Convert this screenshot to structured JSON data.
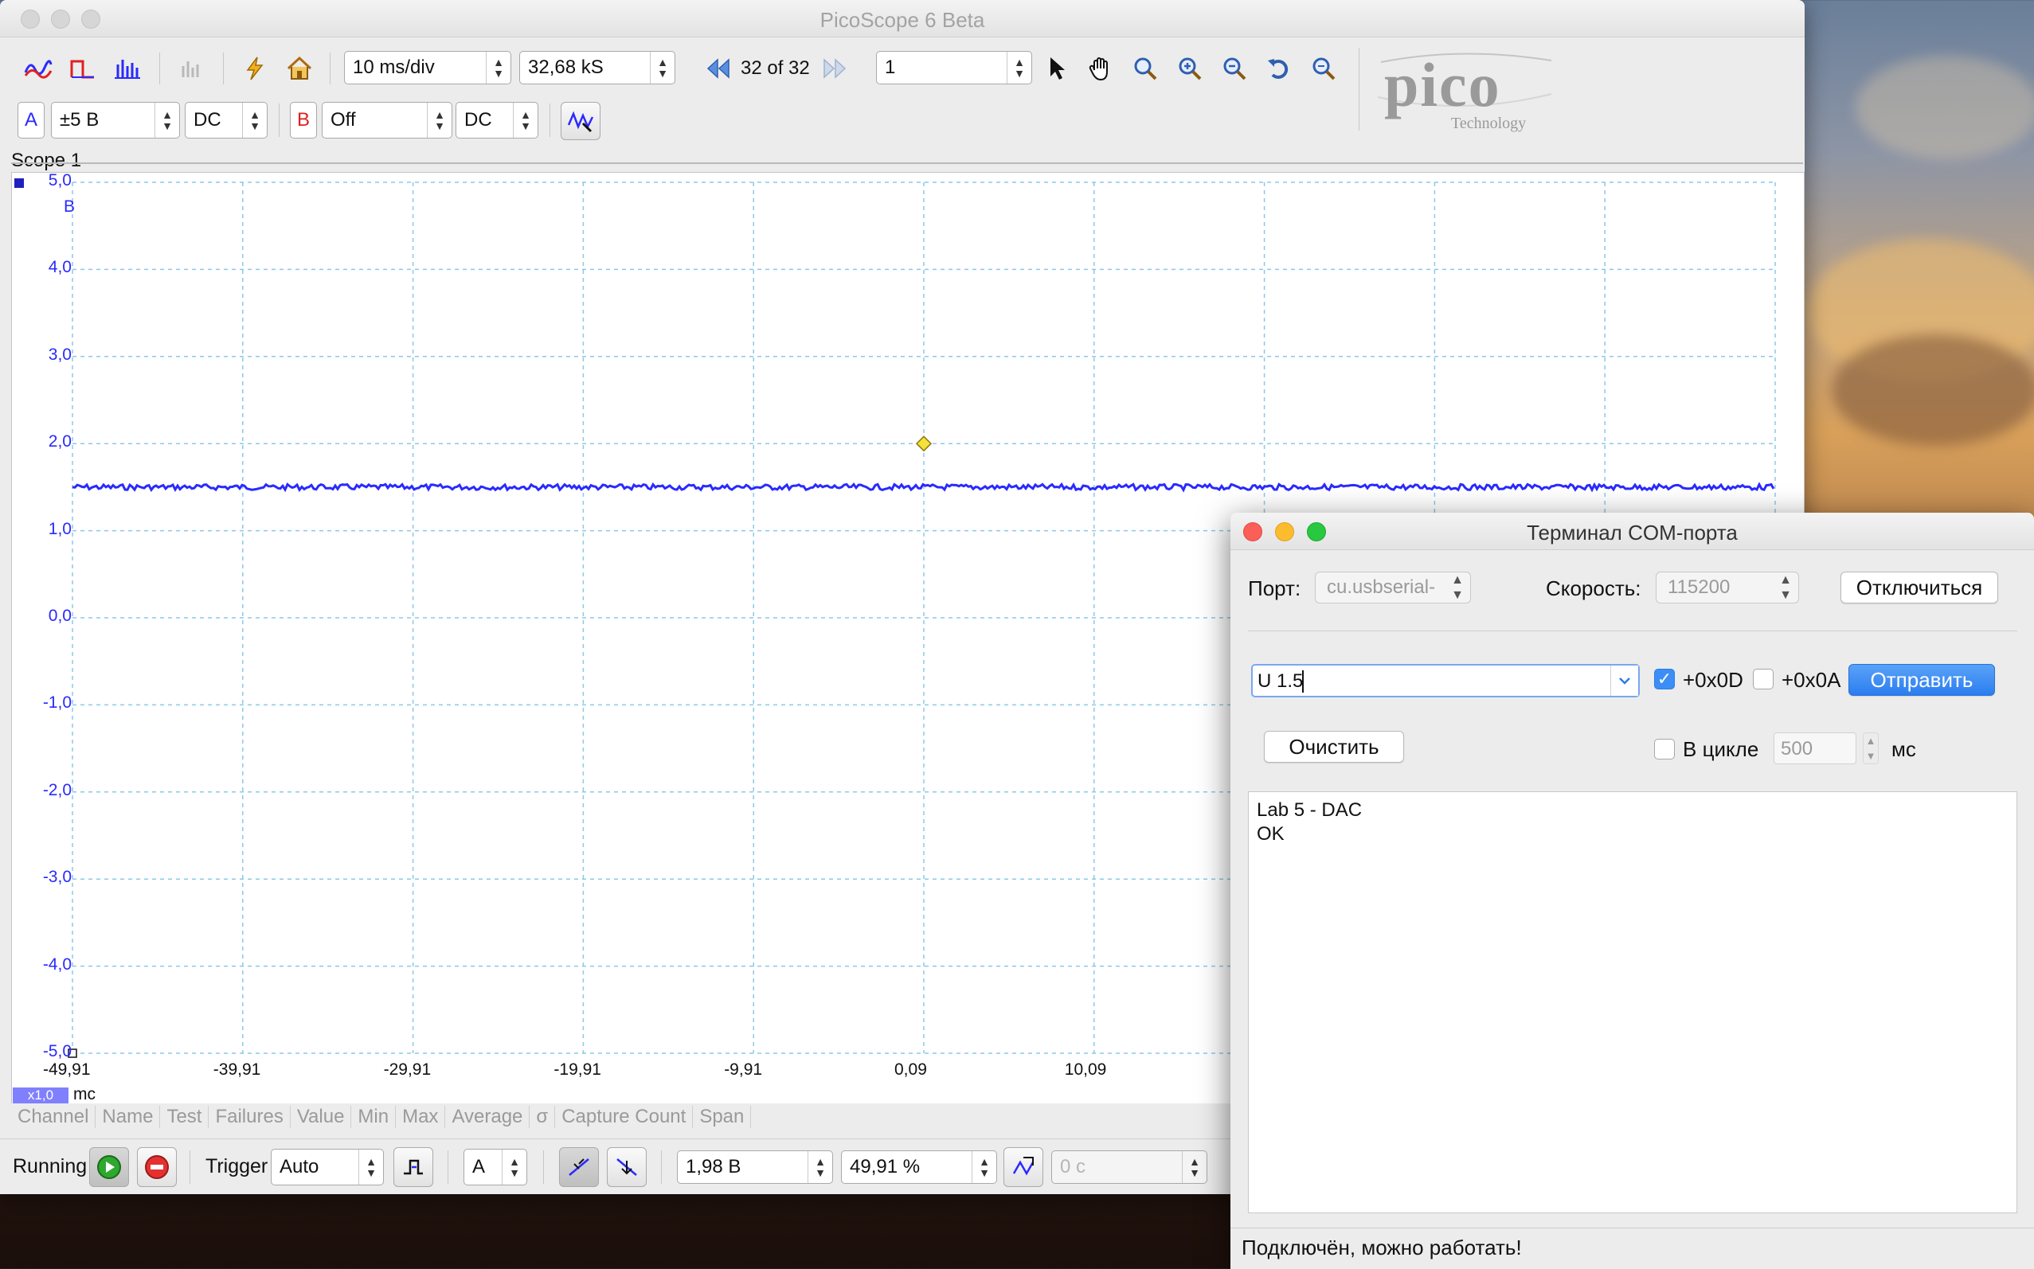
{
  "picoscope": {
    "title": "PicoScope 6 Beta",
    "timebase": "10 ms/div",
    "samples": "32,68 kS",
    "capture_nav": "32 of 32",
    "capture_count": "1",
    "logo_text": "pico",
    "logo_sub": "Technology",
    "channel_a": {
      "label": "A",
      "range": "±5 B",
      "coupling": "DC",
      "color": "#2a2aff"
    },
    "channel_b": {
      "label": "B",
      "range": "Off",
      "coupling": "DC",
      "color": "#e02020"
    },
    "scope_tab": "Scope 1",
    "y_axis": {
      "unit": "B",
      "ticks": [
        "5,0",
        "4,0",
        "3,0",
        "2,0",
        "1,0",
        "0,0",
        "-1,0",
        "-2,0",
        "-3,0",
        "-4,0",
        "-5,0"
      ]
    },
    "x_axis": {
      "unit": "mc",
      "zoom": "x1,0",
      "ticks": [
        "-49,91",
        "-39,91",
        "-29,91",
        "-19,91",
        "-9,91",
        "0,09",
        "10,09"
      ]
    },
    "measurement_columns": [
      "Channel",
      "Name",
      "Test",
      "Failures",
      "Value",
      "Min",
      "Max",
      "Average",
      "σ",
      "Capture Count",
      "Span"
    ],
    "bottom": {
      "running_label": "Running",
      "trigger_label": "Trigger",
      "trigger_mode": "Auto",
      "trigger_channel": "A",
      "trigger_level": "1,98 B",
      "pre_trigger": "49,91 %",
      "delay": "0 c"
    },
    "trace_level_volts": 1.5,
    "trigger_marker": {
      "time": 0.09,
      "volts": 2.0
    }
  },
  "terminal": {
    "title": "Терминал COM-порта",
    "port_label": "Порт:",
    "port_value": "cu.usbserial-",
    "speed_label": "Скорость:",
    "speed_value": "115200",
    "disconnect_button": "Отключиться",
    "command_value": "U 1.5",
    "cr_label": "+0x0D",
    "lf_label": "+0x0A",
    "send_button": "Отправить",
    "clear_button": "Очистить",
    "loop_label": "В цикле",
    "loop_interval": "500",
    "loop_unit": "мс",
    "log": "Lab 5 - DAC\nOK",
    "status": "Подключён, можно работать!"
  }
}
